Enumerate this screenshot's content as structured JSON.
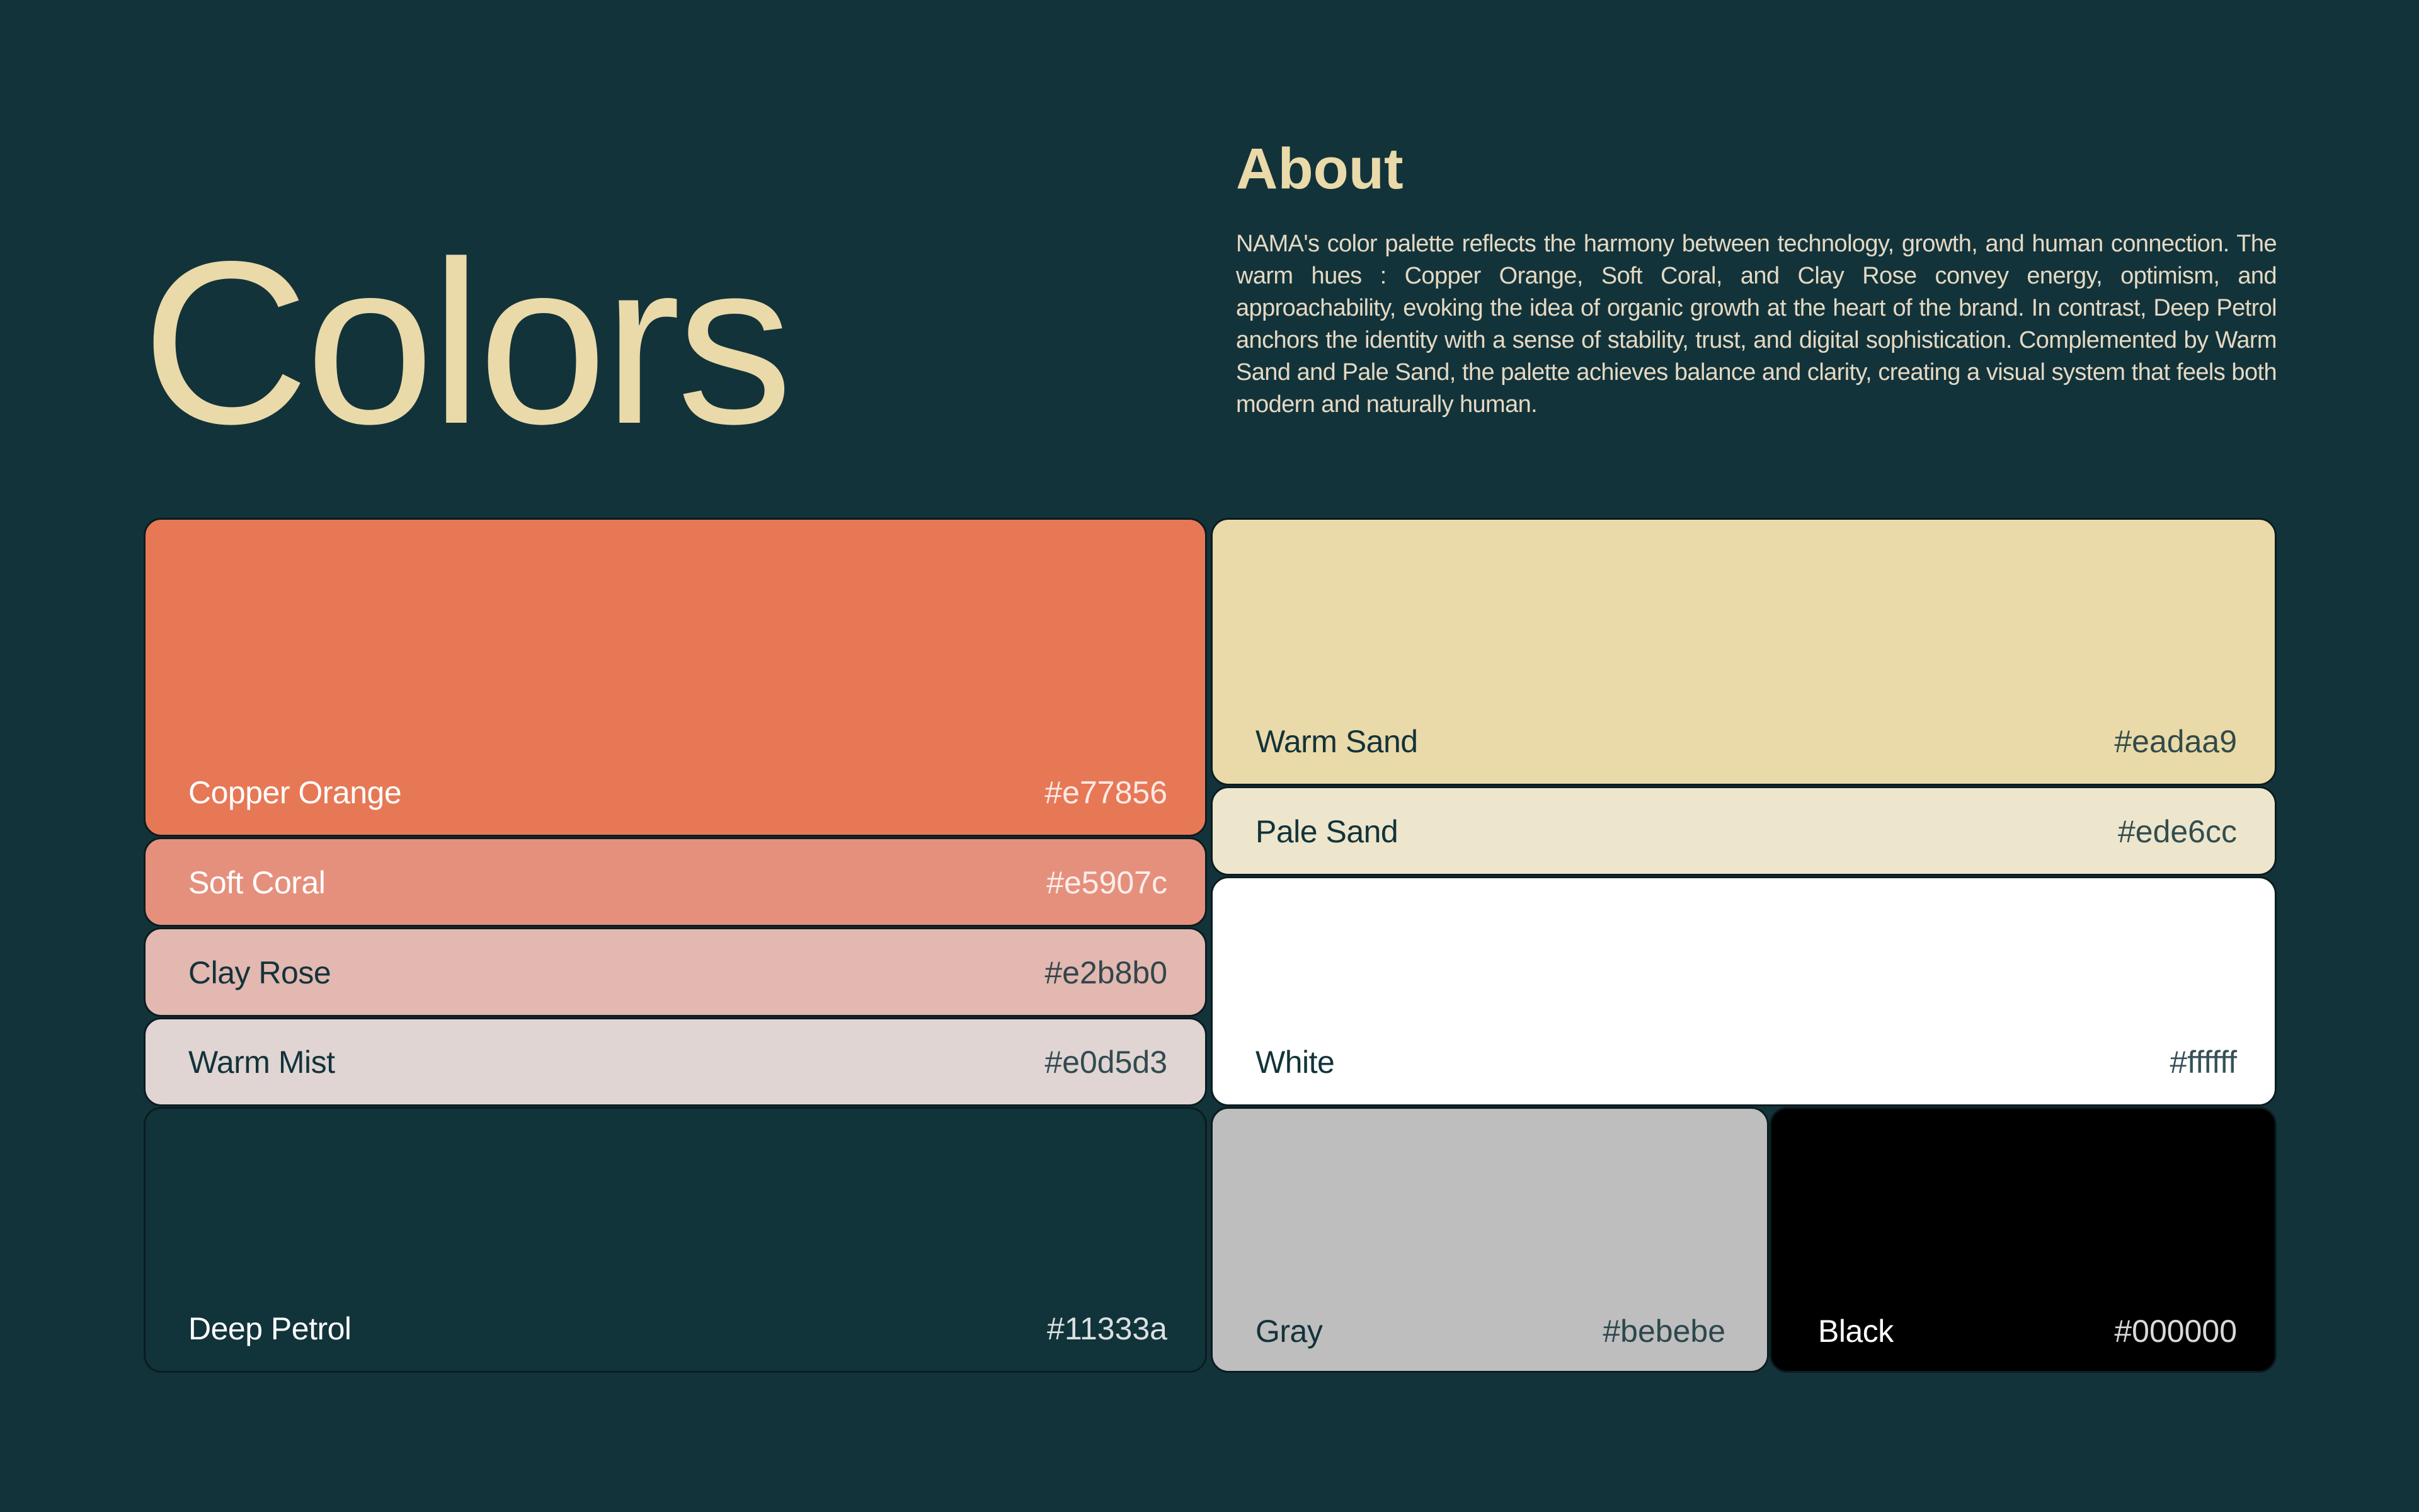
{
  "header": {
    "title": "Colors",
    "about_heading": "About",
    "about_text": "NAMA's color palette reflects the harmony between technology, growth, and human connection. The warm hues : Copper Orange, Soft Coral, and Clay Rose convey energy, optimism, and approachability, evoking the idea of organic growth at the heart of the brand. In contrast, Deep Petrol anchors the identity with a sense of stability, trust, and digital sophistication. Complemented by Warm Sand and Pale Sand, the palette achieves balance and clarity, creating a visual system that feels both modern and naturally human."
  },
  "palette": {
    "copper_orange": {
      "name": "Copper Orange",
      "hex_label": "#e77856",
      "color": "#e77856"
    },
    "soft_coral": {
      "name": "Soft Coral",
      "hex_label": "#e5907c",
      "color": "#e5907c"
    },
    "clay_rose": {
      "name": "Clay Rose",
      "hex_label": "#e2b8b0",
      "color": "#e2b8b0"
    },
    "warm_mist": {
      "name": "Warm Mist",
      "hex_label": "#e0d5d3",
      "color": "#e0d5d3"
    },
    "deep_petrol": {
      "name": "Deep Petrol",
      "hex_label": "#11333a",
      "color": "#11333a"
    },
    "warm_sand": {
      "name": "Warm Sand",
      "hex_label": "#eadaa9",
      "color": "#eadaa9"
    },
    "pale_sand": {
      "name": "Pale Sand",
      "hex_label": "#ede6cc",
      "color": "#ede6cc"
    },
    "white": {
      "name": "White",
      "hex_label": "#ffffff",
      "color": "#ffffff"
    },
    "gray": {
      "name": "Gray",
      "hex_label": "#bebebe",
      "color": "#bebebe"
    },
    "black": {
      "name": "Black",
      "hex_label": "#000000",
      "color": "#000000"
    }
  }
}
